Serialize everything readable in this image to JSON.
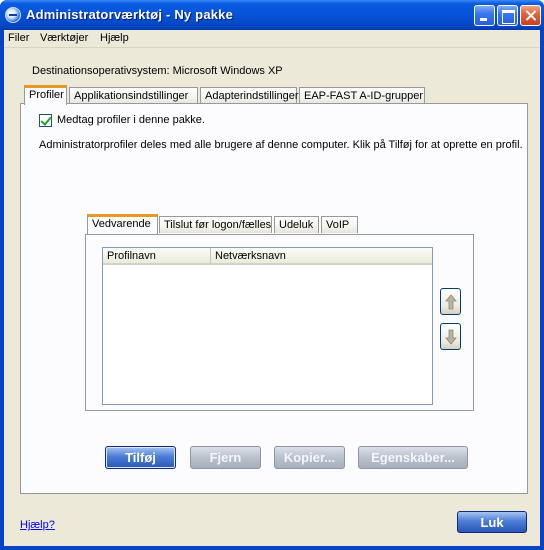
{
  "window": {
    "title": "Administratorværktøj - Ny pakke"
  },
  "menu": {
    "items": [
      "Filer",
      "Værktøjer",
      "Hjælp"
    ]
  },
  "destination": {
    "label": "Destinationsoperativsystem: Microsoft Windows XP"
  },
  "tabs": [
    {
      "label": "Profiler",
      "active": true
    },
    {
      "label": "Applikationsindstillinger",
      "active": false
    },
    {
      "label": "Adapterindstillinger",
      "active": false
    },
    {
      "label": "EAP-FAST A-ID-grupper",
      "active": false
    }
  ],
  "profiles": {
    "include_checkbox_label": "Medtag profiler i denne pakke.",
    "include_checked": true,
    "info_text": "Administratorprofiler deles med alle brugere af denne computer. Klik på Tilføj for at oprette en profil.",
    "inner_tabs": [
      {
        "label": "Vedvarende",
        "active": true
      },
      {
        "label": "Tilslut før logon/fælles",
        "active": false
      },
      {
        "label": "Udeluk",
        "active": false
      },
      {
        "label": "VoIP",
        "active": false
      }
    ],
    "columns": [
      "Profilnavn",
      "Netværksnavn"
    ],
    "rows": [],
    "move_up_icon": "arrow-up-icon",
    "move_down_icon": "arrow-down-icon"
  },
  "buttons": {
    "add": "Tilføj",
    "remove": "Fjern",
    "copy": "Kopier...",
    "properties": "Egenskaber..."
  },
  "footer": {
    "help_link": "Hjælp?",
    "close_button": "Luk"
  },
  "colors": {
    "titlebar": "#0552d8",
    "dialog_bg": "#ece9d8",
    "active_tab_accent": "#e79a22",
    "primary_button": "#2a56b8"
  }
}
